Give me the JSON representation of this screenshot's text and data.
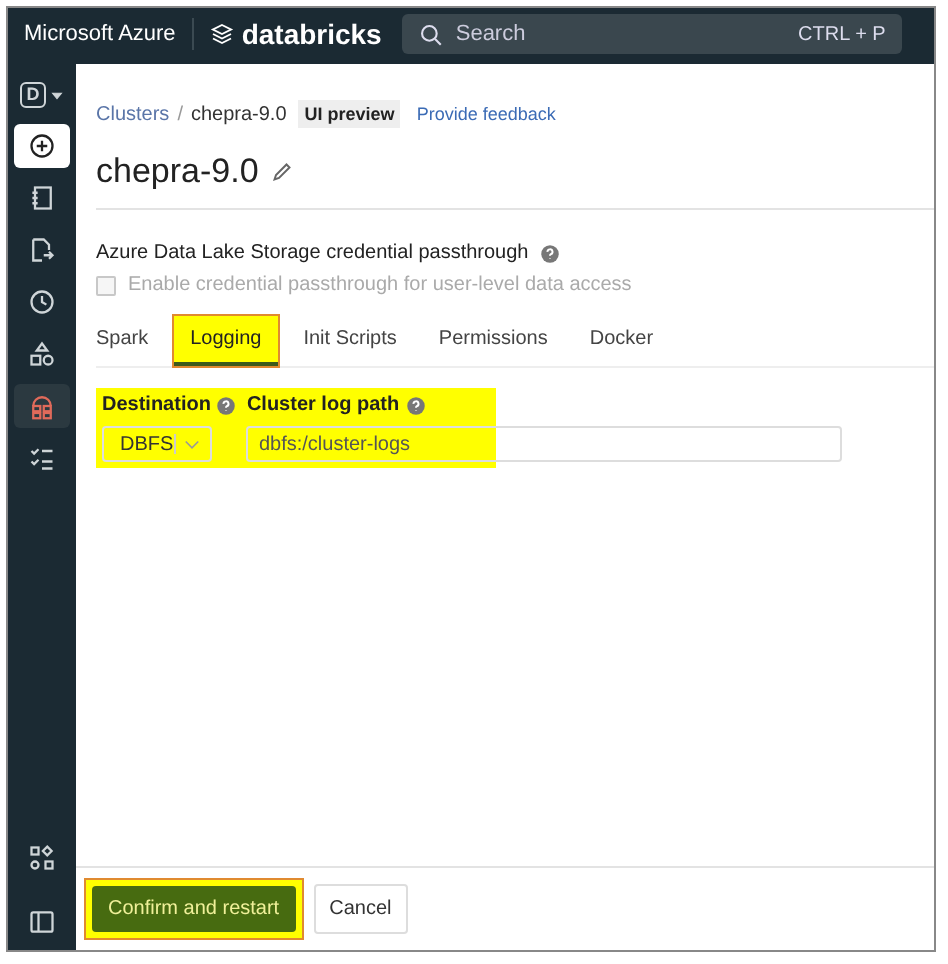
{
  "top_bar": {
    "brand": "Microsoft Azure",
    "product": "databricks",
    "search": {
      "placeholder": "Search",
      "shortcut": "CTRL + P"
    }
  },
  "sidebar": {
    "workspace": "D",
    "items": [
      {
        "kind": "new",
        "selected": false
      },
      {
        "kind": "notebook",
        "selected": false
      },
      {
        "kind": "data",
        "selected": false
      },
      {
        "kind": "clock",
        "selected": false
      },
      {
        "kind": "shapes",
        "selected": false
      },
      {
        "kind": "compute",
        "selected": true
      },
      {
        "kind": "tasks",
        "selected": false
      }
    ],
    "bottom_items": [
      {
        "kind": "partner"
      },
      {
        "kind": "panel"
      }
    ]
  },
  "breadcrumb": {
    "link": "Clusters",
    "separator": "/",
    "current": "chepra-9.0",
    "badge": "UI preview",
    "feedback": "Provide feedback"
  },
  "title": "chepra-9.0",
  "passthrough": {
    "heading": "Azure Data Lake Storage credential passthrough",
    "checkbox": {
      "label": "Enable credential passthrough for user-level data access",
      "checked": false,
      "disabled": true
    }
  },
  "tabs": [
    {
      "label": "Spark",
      "selected": false,
      "highlighted": false
    },
    {
      "label": "Logging",
      "selected": true,
      "highlighted": true
    },
    {
      "label": "Init Scripts",
      "selected": false,
      "highlighted": false
    },
    {
      "label": "Permissions",
      "selected": false,
      "highlighted": false
    },
    {
      "label": "Docker",
      "selected": false,
      "highlighted": false
    }
  ],
  "logging": {
    "highlighted": true,
    "destination": {
      "label": "Destination",
      "value": "DBFS"
    },
    "path": {
      "label": "Cluster log path",
      "value": "dbfs:/cluster-logs"
    }
  },
  "footer": {
    "confirm": {
      "label": "Confirm and restart",
      "highlighted": true
    },
    "cancel": {
      "label": "Cancel"
    }
  }
}
